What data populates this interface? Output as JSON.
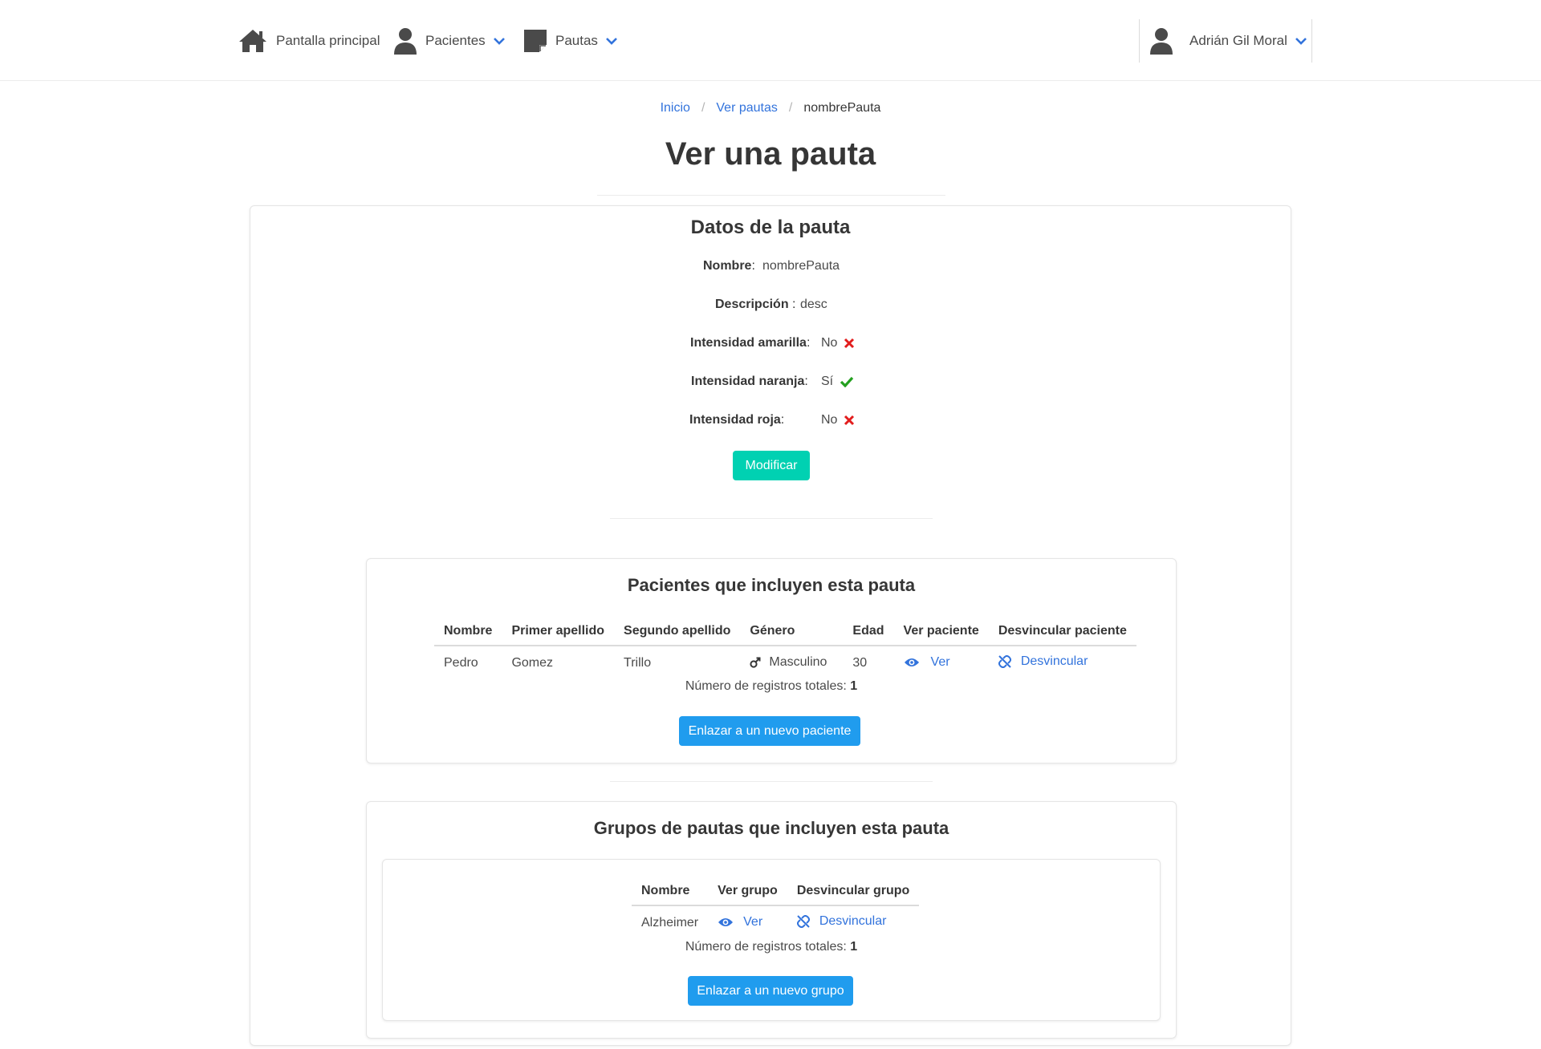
{
  "nav": {
    "home": {
      "label": "Pantalla principal",
      "icon": "home-icon"
    },
    "patients": {
      "label": "Pacientes",
      "icon": "user-icon"
    },
    "guidelines": {
      "label": "Pautas",
      "icon": "sticky-note-icon"
    },
    "user": {
      "label": "Adrián Gil Moral",
      "icon": "user-icon"
    }
  },
  "breadcrumb": {
    "home": "Inicio",
    "list": "Ver pautas",
    "current": "nombrePauta"
  },
  "page_title": "Ver una pauta",
  "details": {
    "title": "Datos de la pauta",
    "name_label": "Nombre",
    "name_value": "nombrePauta",
    "description_label": "Descripción",
    "description_value": "desc",
    "yellow_label": "Intensidad amarilla",
    "yellow_value": "No",
    "orange_label": "Intensidad naranja",
    "orange_value": "Sí",
    "red_label": "Intensidad roja",
    "red_value": "No",
    "modify_button": "Modificar",
    "colors": {
      "yes": "#23a01f",
      "no": "#e21d1d",
      "button": "#00d1b2"
    }
  },
  "patients_section": {
    "title": "Pacientes que incluyen esta pauta",
    "columns": [
      "Nombre",
      "Primer apellido",
      "Segundo apellido",
      "Género",
      "Edad",
      "Ver paciente",
      "Desvincular paciente"
    ],
    "rows": [
      {
        "name": "Pedro",
        "last1": "Gomez",
        "last2": "Trillo",
        "gender": "Masculino",
        "age": "30",
        "view": "Ver",
        "unlink": "Desvincular"
      }
    ],
    "total_label": "Número de registros totales:",
    "total_value": "1",
    "link_button": "Enlazar a un nuevo paciente"
  },
  "groups_section": {
    "title": "Grupos de pautas que incluyen esta pauta",
    "columns": [
      "Nombre",
      "Ver grupo",
      "Desvincular grupo"
    ],
    "rows": [
      {
        "name": "Alzheimer",
        "view": "Ver",
        "unlink": "Desvincular"
      }
    ],
    "total_label": "Número de registros totales:",
    "total_value": "1",
    "link_button": "Enlazar a un nuevo grupo"
  }
}
